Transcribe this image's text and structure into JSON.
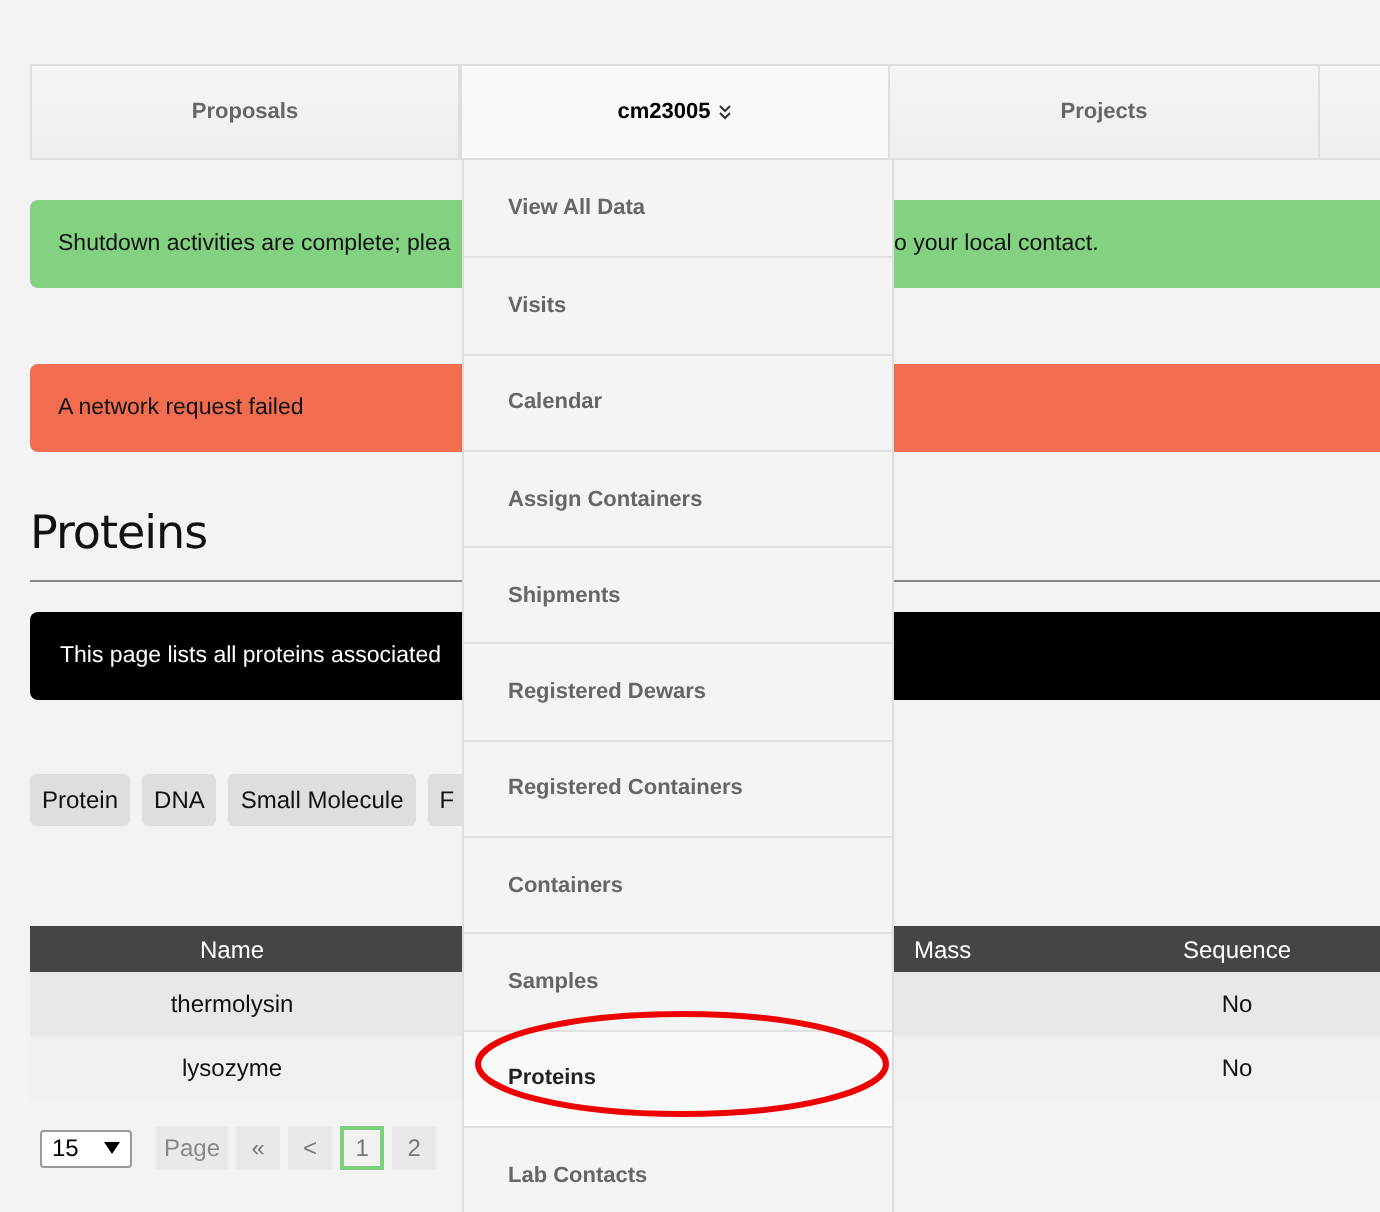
{
  "nav_tabs": [
    {
      "label": "Proposals",
      "selected": false,
      "has_caret": false
    },
    {
      "label": "cm23005",
      "selected": true,
      "has_caret": true
    },
    {
      "label": "Projects",
      "selected": false,
      "has_caret": false
    },
    {
      "selected": false,
      "has_caret": false
    }
  ],
  "alerts": [
    {
      "kind": "success",
      "left_text": "Shutdown activities are complete; plea",
      "right_text": "o your local contact."
    },
    {
      "kind": "error",
      "left_text": "A network request failed"
    }
  ],
  "heading": "Proteins",
  "info_text": "This page lists all proteins associated",
  "type_tags": [
    "Protein",
    "DNA",
    "Small Molecule",
    "F"
  ],
  "table": {
    "columns": [
      "Name",
      "Mass",
      "Sequence"
    ],
    "rows": [
      {
        "name": "thermolysin",
        "sequence": "No"
      },
      {
        "name": "lysozyme",
        "sequence": "No"
      }
    ]
  },
  "pagination": {
    "page_size": "15",
    "page_label": "Page",
    "first": "«",
    "prev": "<",
    "pages": [
      {
        "label": "1",
        "selected": true
      },
      {
        "label": "2",
        "selected": false
      }
    ]
  },
  "dropdown": {
    "items": [
      {
        "label": "View All Data",
        "selected": false,
        "highlighted": false
      },
      {
        "label": "Visits",
        "selected": false,
        "highlighted": false
      },
      {
        "label": "Calendar",
        "selected": false,
        "highlighted": false
      },
      {
        "label": "Assign Containers",
        "selected": false,
        "highlighted": false
      },
      {
        "label": "Shipments",
        "selected": false,
        "highlighted": false
      },
      {
        "label": "Registered Dewars",
        "selected": false,
        "highlighted": false
      },
      {
        "label": "Registered Containers",
        "selected": false,
        "highlighted": false
      },
      {
        "label": "Containers",
        "selected": false,
        "highlighted": false
      },
      {
        "label": "Samples",
        "selected": false,
        "highlighted": false
      },
      {
        "label": "Proteins",
        "selected": true,
        "highlighted": true
      },
      {
        "label": "Lab Contacts",
        "selected": false,
        "highlighted": false
      }
    ]
  }
}
